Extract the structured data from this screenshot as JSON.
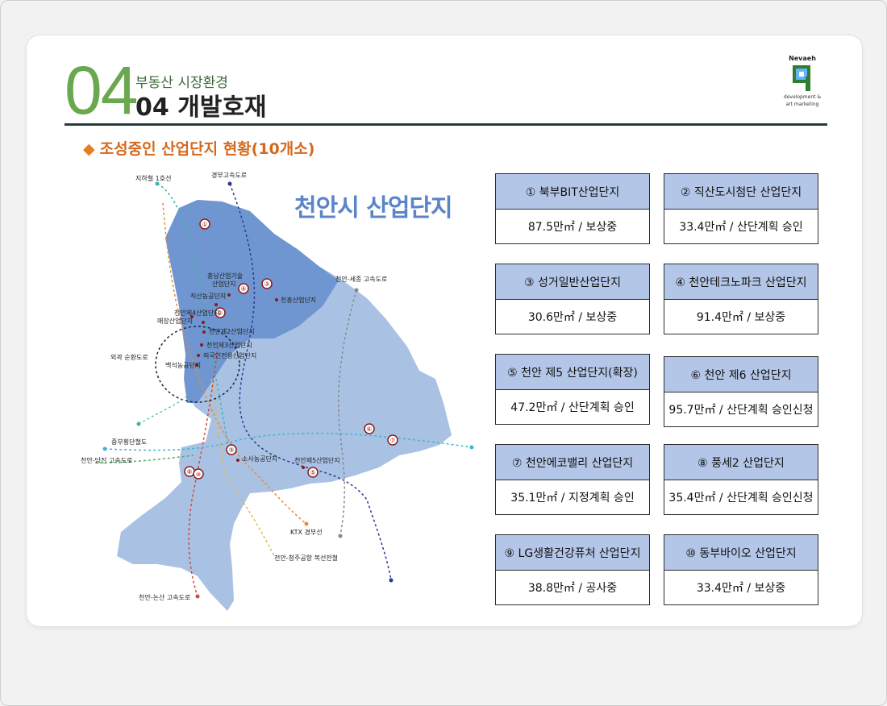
{
  "header": {
    "big_number": "04",
    "subtitle": "부동산 시장환경",
    "title": "04 개발호재"
  },
  "logo": {
    "brand": "Nevaeh",
    "tagline_1": "development &",
    "tagline_2": "art marketing"
  },
  "section": {
    "bullet": "◆",
    "title": "조성중인 산업단지 현황(10개소)"
  },
  "map": {
    "title": "천안시 산업단지",
    "labels": {
      "subway": "지하철 1호선",
      "gyeongbu": "경부고속도로",
      "chungnam_tech": "충남산업기술",
      "industrial_complex": "산업단지",
      "jiksan": "직산농공단지",
      "cheonheung": "천흥산업단지",
      "cheonan_sejong": "천안-세종 고속도로",
      "cheonan4": "천안제4산업단지",
      "maejang": "매장산업단지",
      "cheonan2": "천안제2산업단지",
      "cheonan3": "천안제3산업단지",
      "foreign": "외국인전용산업단지",
      "baekseok": "백석농공단지",
      "outer_ring": "외곽 순환도로",
      "jungbu": "중부횡단철도",
      "dangjin": "천안-당진 고속도로",
      "sosa": "소사농공단지",
      "cheonan5": "천안제5산업단지",
      "ktx": "KTX 경부선",
      "cheongju": "천안-청주공항 복선전철",
      "nonsan": "천안-논산 고속도로"
    },
    "markers": [
      "①",
      "②",
      "③",
      "④",
      "⑤",
      "⑥",
      "⑦",
      "⑧",
      "⑨",
      "⑩"
    ]
  },
  "complexes": [
    {
      "name": "① 북부BIT산업단지",
      "info": "87.5만㎡ / 보상중"
    },
    {
      "name": "② 직산도시첨단 산업단지",
      "info": "33.4만㎡ / 산단계획 승인"
    },
    {
      "name": "③ 성거일반산업단지",
      "info": "30.6만㎡ / 보상중"
    },
    {
      "name": "④ 천안테크노파크 산업단지",
      "info": "91.4만㎡ / 보상중"
    },
    {
      "name": "⑤ 천안 제5 산업단지(확장)",
      "info": "47.2만㎡ / 산단계획 승인"
    },
    {
      "name": "⑥ 천안 제6 산업단지",
      "info": "95.7만㎡ / 산단계획 승인신청"
    },
    {
      "name": "⑦ 천안에코밸리 산업단지",
      "info": "35.1만㎡ / 지정계획 승인"
    },
    {
      "name": "⑧ 풍세2 산업단지",
      "info": "35.4만㎡ / 산단계획 승인신청"
    },
    {
      "name": "⑨ LG생활건강퓨처 산업단지",
      "info": "38.8만㎡ / 공사중"
    },
    {
      "name": "⑩ 동부바이오 산업단지",
      "info": "33.4만㎡ / 보상중"
    }
  ],
  "colors": {
    "accent_green": "#6aa84f",
    "section_orange": "#d4691e",
    "card_header": "#b4c6e7",
    "map_light": "#a9c2e4",
    "map_dark": "#6f96d1"
  }
}
